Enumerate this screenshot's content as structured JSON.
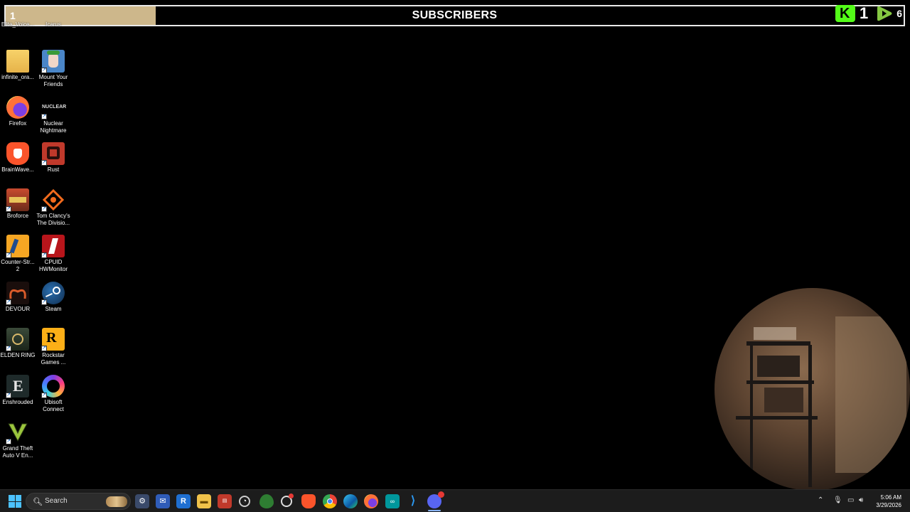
{
  "overlay": {
    "current_count": "1",
    "goal_fill_fraction": 0.167,
    "title": "SUBSCRIBERS",
    "kick_count": "1",
    "rumble_count": "6"
  },
  "desktop": {
    "icons": [
      {
        "label": "Elite_Voice...",
        "icon": "voice-app-icon"
      },
      {
        "label": "Icarus",
        "icon": "icarus-icon"
      },
      {
        "label": "infinite_ora...",
        "icon": "folder-icon"
      },
      {
        "label": "Mount Your Friends",
        "icon": "mount-your-friends-icon"
      },
      {
        "label": "Firefox",
        "icon": "firefox-icon"
      },
      {
        "label": "Nuclear Nightmare",
        "icon": "nuclear-nightmare-icon"
      },
      {
        "label": "BrainWave...",
        "icon": "brave-lion-icon"
      },
      {
        "label": "Rust",
        "icon": "rust-icon"
      },
      {
        "label": "Broforce",
        "icon": "broforce-icon"
      },
      {
        "label": "Tom Clancy's The Divisio...",
        "icon": "division-icon"
      },
      {
        "label": "Counter-Str... 2",
        "icon": "counter-strike-icon"
      },
      {
        "label": "CPUID HWMonitor",
        "icon": "hwmonitor-icon"
      },
      {
        "label": "DEVOUR",
        "icon": "devour-icon"
      },
      {
        "label": "Steam",
        "icon": "steam-icon"
      },
      {
        "label": "ELDEN RING",
        "icon": "elden-ring-icon"
      },
      {
        "label": "Rockstar Games ...",
        "icon": "rockstar-icon"
      },
      {
        "label": "Enshrouded",
        "icon": "enshrouded-icon"
      },
      {
        "label": "Ubisoft Connect",
        "icon": "ubisoft-icon"
      },
      {
        "label": "Grand Theft Auto V En...",
        "icon": "gta-v-icon"
      }
    ]
  },
  "taskbar": {
    "search_label": "Search",
    "apps": [
      "start-icon",
      "search-icon",
      "network-tool-icon",
      "mail-icon",
      "app-r-icon",
      "file-explorer-icon",
      "news-app-icon",
      "clock-app-icon",
      "browser-shield-icon",
      "obs-icon",
      "brave-icon",
      "chrome-icon",
      "edge-icon",
      "firefox-icon",
      "arduino-icon",
      "vscode-icon",
      "discord-icon"
    ],
    "time": "5:06 AM",
    "date": "3/29/2026"
  },
  "colors": {
    "progress_fill": "#cdb78b",
    "kick_green": "#53fc18",
    "rumble_green": "#85c742",
    "taskbar_bg": "#1c1c1c"
  }
}
